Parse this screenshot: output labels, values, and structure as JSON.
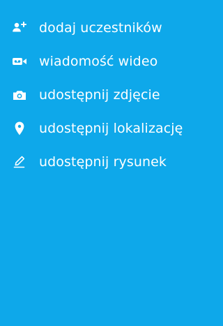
{
  "colors": {
    "background": "#0ea8ea",
    "foreground": "#ffffff"
  },
  "menu": {
    "items": [
      {
        "label": "dodaj uczestników",
        "icon": "add-person-icon"
      },
      {
        "label": "wiadomość wideo",
        "icon": "video-message-icon"
      },
      {
        "label": "udostępnij zdjęcie",
        "icon": "camera-icon"
      },
      {
        "label": "udostępnij lokalizację",
        "icon": "location-pin-icon"
      },
      {
        "label": "udostępnij rysunek",
        "icon": "pen-icon"
      }
    ]
  }
}
